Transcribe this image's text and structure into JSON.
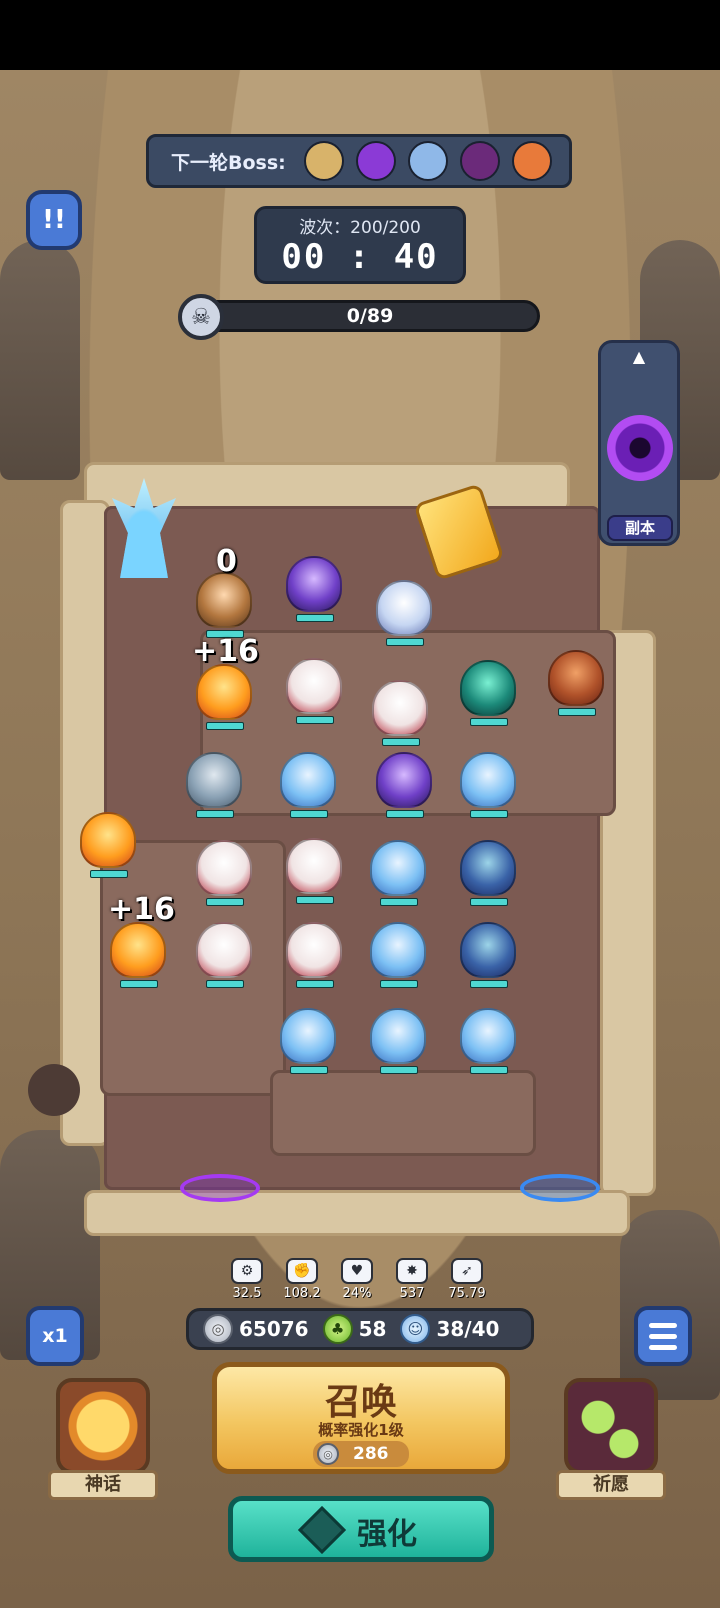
{
  "header": {
    "next_boss_label": "下一轮Boss:",
    "boss_avatars": [
      {
        "name": "wizard-boss",
        "color": "#d8b36a"
      },
      {
        "name": "purple-boss",
        "color": "#8b3ad6"
      },
      {
        "name": "ice-boss",
        "color": "#8fb8e8"
      },
      {
        "name": "shadow-boss",
        "color": "#6b2a7a"
      },
      {
        "name": "fire-boss",
        "color": "#e87a3a"
      }
    ],
    "wave_label": "波次：200/200",
    "timer": "00 : 40",
    "kill_progress": "0/89"
  },
  "dungeon": {
    "label": "副本",
    "up_icon": "chevron-up-icon"
  },
  "battlefield": {
    "float_texts": [
      "0",
      "+16",
      "+16"
    ]
  },
  "stats": [
    {
      "icon": "attack-speed-icon",
      "glyph": "⚙",
      "value": "32.5"
    },
    {
      "icon": "fist-icon",
      "glyph": "✊",
      "value": "108.2"
    },
    {
      "icon": "heart-icon",
      "glyph": "♥",
      "value": "24%"
    },
    {
      "icon": "crit-icon",
      "glyph": "✸",
      "value": "537"
    },
    {
      "icon": "bow-icon",
      "glyph": "➶",
      "value": "75.79"
    }
  ],
  "resources": {
    "silver": "65076",
    "clover": "58",
    "units": "38/40"
  },
  "controls": {
    "speed_label": "x1",
    "pause_glyph": "!!"
  },
  "summon": {
    "title": "召唤",
    "subtitle": "概率强化1级",
    "cost": "286"
  },
  "upgrade": {
    "label": "强化"
  },
  "side_buttons": {
    "myth_label": "神话",
    "pray_label": "祈愿"
  }
}
